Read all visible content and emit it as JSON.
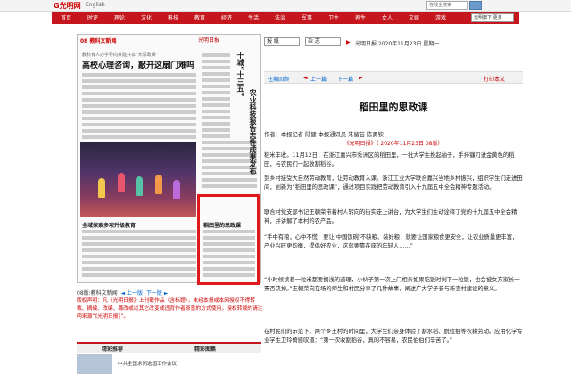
{
  "topbar": {
    "logo": "G光明网",
    "english": "English",
    "search_placeholder": "在线全搜索"
  },
  "nav": {
    "items": [
      "首页",
      "时评",
      "理论",
      "文化",
      "科技",
      "教育",
      "经济",
      "生活",
      "法治",
      "军事",
      "卫生",
      "养生",
      "女人",
      "文娱",
      "游戏"
    ],
    "more": "光明旗下·更多"
  },
  "paper": {
    "edition": "08 教科文新闻",
    "logo": "光明日报",
    "subtitle": "教科育人办学导向共建共享“大思政课”",
    "headline": "高校心理咨询，敲开这扇门难吗",
    "vertical_headline_1": "十城“十三五”",
    "vertical_headline_2": "农业科技报告志性成果发布",
    "small_headline": "全域探索多项升级教育",
    "highlight_title": "稻田里的思政课"
  },
  "page_nav": {
    "current": "08版:教科文新闻",
    "prev": "上一版",
    "next": "下一版"
  },
  "notice": "版权声明：凡《光明日报》上刊载作品（含标题），未经本报或本网授权不得转载、摘编、改编、篡改或以其它改变或违背作者原意的方式使用，授权转载的请注明来源“《光明日报》”。",
  "tabs": {
    "left": "精彩推荐",
    "right": "精彩图集"
  },
  "bottom_text": "中共全国求问选国工作会议",
  "controls": {
    "edition_select": "报 纸",
    "issue_select": "杂 志",
    "date_label": "光明日报  2020年11月23日 星期一"
  },
  "sub_nav": {
    "prev_article": "往期回顾",
    "prev_article2": "上一篇",
    "next_article": "下一篇",
    "print": "打印本文"
  },
  "article": {
    "title": "稻田里的思政课",
    "byline": "作者：本报记者 陆健 本报通讯员 朱留芸 陈勇钦",
    "source": "《光明日报》（ 2020年11月23日 08版）",
    "paragraphs": [
      "稻米丰收。11月12日，在浙江嘉兴市秀洲区的稻田里，一批大学生挽起袖子，手持镰刀进金黄色的稻田，与农民们一起收割稻谷。",
      "到乡村接受大自然劳动教育，让劳动教育入课。浙江工业大学联合嘉兴当地乡村振兴，组织学生们走进田间，创新为“稻田里的思政课”，通过项目实践把劳动教育引入十九届五中全会精神专题活动。",
      "联合村党支部书记王朝荣带着村人转向的街实走上讲台，为大学生们生动诠释了党的十九届五中全会精神，并讲解了本村的农产品。",
      "“手中有粮，心中不慌！要让‘中国饭碗’不缺粮、装好粮，就要让国家粮食更安全，让农业质量更丰富，产业兴旺更均衡，提倡好农业，这就要靠在座的年轻人……”",
      "“小时候读着一粒米都要搁浅的道理，小伙子第一次上门相亲如果吃饭时剩下一粒饭，也会被女方家长一票否决掉。”王朝荣向在场的师生和村民分享了几种故事，阐述广大学子参与新农村建设的意义。",
      "在村民们的示范下，两个乡土村的时间里，大学生们亲身体验了割水稻、脱粒捆等农耕劳动。应用化学专业学生卫玲倚感叹道：“第一次收割稻谷，真的不容易，农民伯伯们辛苦了。”"
    ]
  }
}
